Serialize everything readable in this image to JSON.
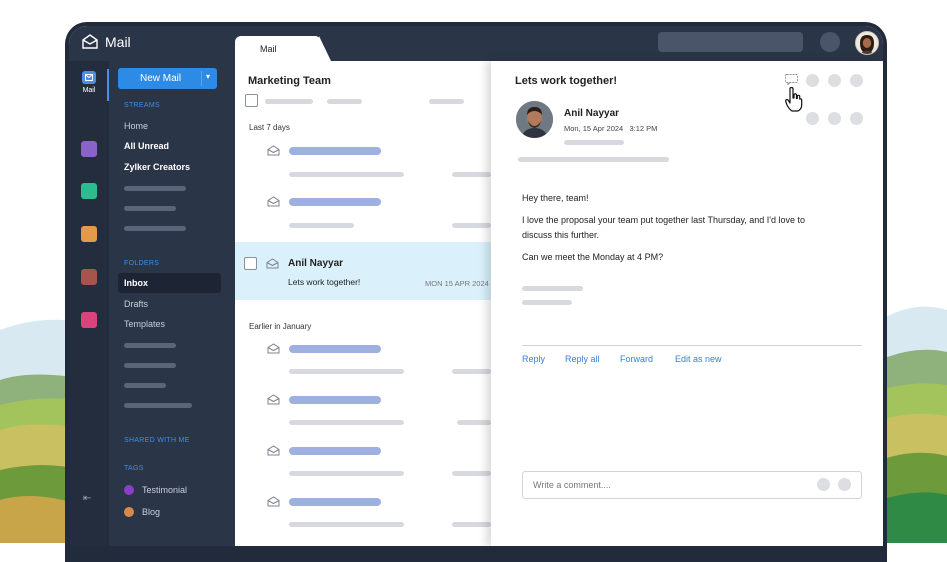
{
  "app": {
    "title": "Mail",
    "tab": "Mail"
  },
  "rail": {
    "mail_label": "Mail",
    "app_colors": [
      "#8a63c9",
      "#2bbd8e",
      "#e39a4b",
      "#a5564c",
      "#d8457c"
    ]
  },
  "sidebar": {
    "new_mail": "New Mail",
    "streams_heading": "STREAMS",
    "streams": [
      "Home",
      "All Unread",
      "Zylker Creators"
    ],
    "folders_heading": "FOLDERS",
    "folders": [
      "Inbox",
      "Drafts",
      "Templates"
    ],
    "shared_heading": "SHARED WITH ME",
    "tags_heading": "TAGS",
    "tags": [
      {
        "label": "Testimonial",
        "color": "#8a3fc4"
      },
      {
        "label": "Blog",
        "color": "#d7894a"
      }
    ]
  },
  "list": {
    "title": "Marketing Team",
    "group1": "Last 7 days",
    "group2": "Earlier in January",
    "selected": {
      "name": "Anil Nayyar",
      "subject": "Lets work together!",
      "date": "MON 15 APR 2024"
    }
  },
  "reader": {
    "subject": "Lets work together!",
    "sender": "Anil Nayyar",
    "date": "Mon, 15 Apr 2024",
    "time": "3:12 PM",
    "body": [
      "Hey there, team!",
      "I love the proposal your team put together last Thursday, and I'd love to",
      "discuss this further.",
      "Can we meet the Monday at 4 PM?"
    ],
    "actions": [
      "Reply",
      "Reply all",
      "Forward",
      "Edit as new"
    ],
    "comment_placeholder": "Write a comment...."
  },
  "colors": {
    "accent": "#2d8be6",
    "sidebar_bg": "#2b3548",
    "selected_row": "#daf1fb"
  }
}
